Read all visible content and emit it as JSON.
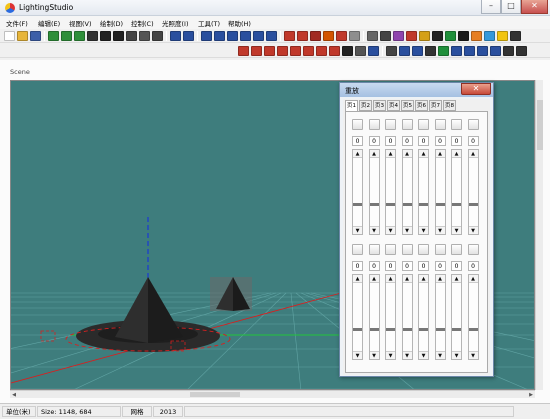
{
  "window": {
    "title": "LightingStudio"
  },
  "menu": [
    {
      "label": "文件(F)"
    },
    {
      "label": "编辑(E)"
    },
    {
      "label": "视图(V)"
    },
    {
      "label": "绘制(D)"
    },
    {
      "label": "控制(C)"
    },
    {
      "label": "光照度(I)"
    },
    {
      "label": "工具(T)"
    },
    {
      "label": "帮助(H)"
    }
  ],
  "toolbar1_icons": [
    {
      "icon": "new-file-icon",
      "color": "#ffffff"
    },
    {
      "icon": "open-folder-icon",
      "color": "#e7b53a"
    },
    {
      "icon": "save-icon",
      "color": "#3d5fa8"
    },
    {
      "icon": "rotate-x-icon",
      "color": "#2f8f3a"
    },
    {
      "icon": "rotate-y-icon",
      "color": "#2f8f3a"
    },
    {
      "icon": "rotate-z-icon",
      "color": "#2f8f3a"
    },
    {
      "icon": "pan-icon",
      "color": "#333333"
    },
    {
      "icon": "select-arrow-icon",
      "color": "#222222"
    },
    {
      "icon": "move-icon",
      "color": "#222222"
    },
    {
      "icon": "camera-icon",
      "color": "#444444"
    },
    {
      "icon": "zoom-icon",
      "color": "#555555"
    },
    {
      "icon": "orbit-icon",
      "color": "#444444"
    },
    {
      "icon": "undo-icon",
      "color": "#2a4f9e"
    },
    {
      "icon": "redo-icon",
      "color": "#2a4f9e"
    },
    {
      "icon": "fit-icon",
      "color": "#2a4f9e"
    },
    {
      "icon": "grid-snap-icon",
      "color": "#2a4f9e"
    },
    {
      "icon": "copy-icon",
      "color": "#2a4f9e"
    },
    {
      "icon": "link-icon",
      "color": "#2a4f9e"
    },
    {
      "icon": "rotate-icon",
      "color": "#2a4f9e"
    },
    {
      "icon": "mirror-icon",
      "color": "#2a4f9e"
    },
    {
      "icon": "grid-red-icon",
      "color": "#c0392b"
    },
    {
      "icon": "cube-red-icon",
      "color": "#c0392b"
    },
    {
      "icon": "cube-dark-red-icon",
      "color": "#a12a22"
    },
    {
      "icon": "cube-orange-icon",
      "color": "#d35400"
    },
    {
      "icon": "cube-wire-icon",
      "color": "#c0392b"
    },
    {
      "icon": "cube-gray-icon",
      "color": "#8e8e8e"
    },
    {
      "icon": "view-icon",
      "color": "#666666"
    },
    {
      "icon": "pencil-icon",
      "color": "#444444"
    },
    {
      "icon": "brush-icon",
      "color": "#8e44ad"
    },
    {
      "icon": "eraser-icon",
      "color": "#c0392b"
    },
    {
      "icon": "palette-icon",
      "color": "#d4a017"
    },
    {
      "icon": "texture-icon",
      "color": "#222222"
    },
    {
      "icon": "image-icon",
      "color": "#1f8f3a"
    },
    {
      "icon": "render-icon",
      "color": "#1a1a1a"
    },
    {
      "icon": "light-icon",
      "color": "#e67e22"
    },
    {
      "icon": "spectrum-icon",
      "color": "#3498db"
    },
    {
      "icon": "sun-icon",
      "color": "#f1c40f"
    },
    {
      "icon": "chart-icon",
      "color": "#333333"
    }
  ],
  "toolbar2_icons": [
    {
      "icon": "sphere-icon",
      "color": "#c0392b"
    },
    {
      "icon": "box-icon",
      "color": "#c0392b"
    },
    {
      "icon": "cylinder-icon",
      "color": "#c0392b"
    },
    {
      "icon": "cone-icon",
      "color": "#c0392b"
    },
    {
      "icon": "pyramid-icon",
      "color": "#c0392b"
    },
    {
      "icon": "wall-icon",
      "color": "#c0392b"
    },
    {
      "icon": "stairs-icon",
      "color": "#c0392b"
    },
    {
      "icon": "mesh-icon",
      "color": "#c0392b"
    },
    {
      "icon": "rect-icon",
      "color": "#222222"
    },
    {
      "icon": "document-icon",
      "color": "#555555"
    },
    {
      "icon": "text-icon",
      "color": "#2a4f9e"
    },
    {
      "icon": "tools-icon",
      "color": "#444444"
    },
    {
      "icon": "arrows-down-icon",
      "color": "#2a4f9e"
    },
    {
      "icon": "arrows-up-icon",
      "color": "#2a4f9e"
    },
    {
      "icon": "light-bulb-icon",
      "color": "#333333"
    },
    {
      "icon": "cube-green-icon",
      "color": "#1f8f3a"
    },
    {
      "icon": "cube-blue-icon",
      "color": "#2a4f9e"
    },
    {
      "icon": "bars-icon",
      "color": "#2a4f9e"
    },
    {
      "icon": "lines-icon",
      "color": "#2a4f9e"
    },
    {
      "icon": "list-icon",
      "color": "#2a4f9e"
    },
    {
      "icon": "fixture-icon",
      "color": "#333333"
    },
    {
      "icon": "wave-icon",
      "color": "#333333"
    }
  ],
  "scene": {
    "label": "Scene",
    "colors": {
      "background": "#3e7d7d",
      "grid": "#5fa7a7",
      "axis_x": "#d62020",
      "axis_y": "#22c53a",
      "axis_z": "#1b3ad6"
    }
  },
  "playback_panel": {
    "title": "重放",
    "pages": [
      {
        "label": "页1"
      },
      {
        "label": "页2"
      },
      {
        "label": "页3"
      },
      {
        "label": "页4"
      },
      {
        "label": "页5"
      },
      {
        "label": "页6"
      },
      {
        "label": "页7"
      },
      {
        "label": "页8"
      }
    ],
    "active_page": "页1",
    "top_row": [
      {
        "value": "0"
      },
      {
        "value": "0"
      },
      {
        "value": "0"
      },
      {
        "value": "0"
      },
      {
        "value": "0"
      },
      {
        "value": "0"
      },
      {
        "value": "0"
      },
      {
        "value": "0"
      }
    ],
    "bottom_row": [
      {
        "value": "0"
      },
      {
        "value": "0"
      },
      {
        "value": "0"
      },
      {
        "value": "0"
      },
      {
        "value": "0"
      },
      {
        "value": "0"
      },
      {
        "value": "0"
      },
      {
        "value": "0"
      }
    ],
    "arrow_up": "▲",
    "arrow_down": "▼"
  },
  "status": {
    "unit": "单位(米)",
    "size": "Size: 1148, 684",
    "grid": "网格",
    "count": "2013"
  }
}
